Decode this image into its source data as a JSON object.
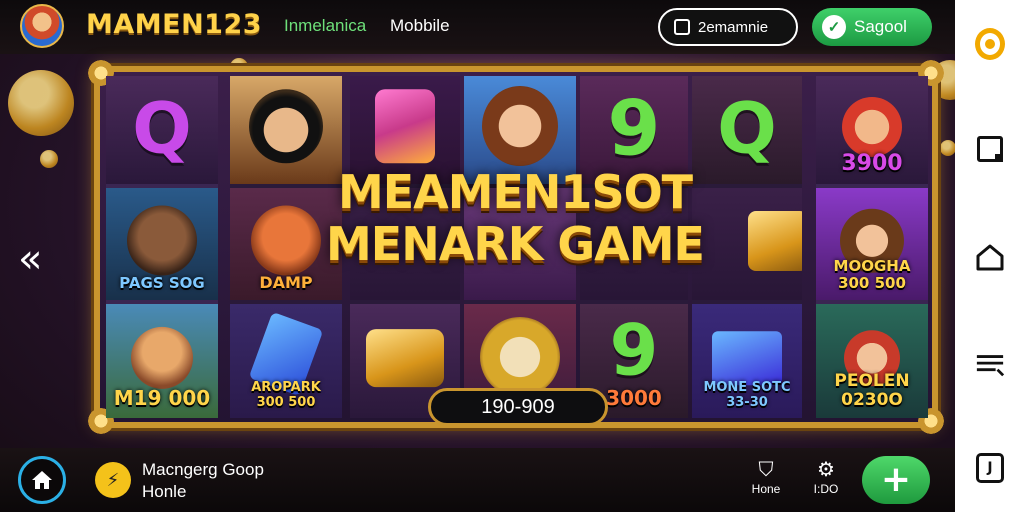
{
  "header": {
    "brand": "MAMEN123",
    "nav": [
      "Inmelanica",
      "Mobbile"
    ],
    "search_pill_label": "2emamnie",
    "green_pill_label": "Sagool"
  },
  "title": {
    "line1": "MEAMEN1SOT",
    "line2": "MENARK GAME"
  },
  "reels": {
    "left": [
      {
        "label": "",
        "symbol": "Q"
      },
      {
        "label": "PAGS SOG"
      },
      {
        "label": "M19 000"
      }
    ],
    "r1": [
      {
        "label": ""
      },
      {
        "label": "DAMP"
      },
      {
        "label": "AROPARK 300 500"
      }
    ],
    "r2": [
      {
        "label": ""
      },
      {
        "label": ""
      },
      {
        "label": ""
      }
    ],
    "r3": [
      {
        "label": ""
      },
      {
        "label": ""
      },
      {
        "label": ""
      }
    ],
    "r4": [
      {
        "label": "",
        "symbol": "9"
      },
      {
        "label": ""
      },
      {
        "label": "3000",
        "symbol": "9"
      }
    ],
    "r5": [
      {
        "label": "",
        "symbol": "Q"
      },
      {
        "label": ""
      },
      {
        "label": "MONE SOTC 33-30"
      }
    ],
    "right": [
      {
        "label": "3900"
      },
      {
        "label": "MOOGHA 300 500"
      },
      {
        "label": "PEOLEN 0230O"
      }
    ]
  },
  "balance": "190-909",
  "footer": {
    "app_line1": "Macngerg Goop",
    "app_line2": "Honle",
    "mini1": "Hone",
    "mini2": "I:DO"
  },
  "colors": {
    "gold": "#ffd54a",
    "frame": "#c9952e",
    "green": "#2bb04e",
    "accent_blue": "#2bb0e6"
  }
}
